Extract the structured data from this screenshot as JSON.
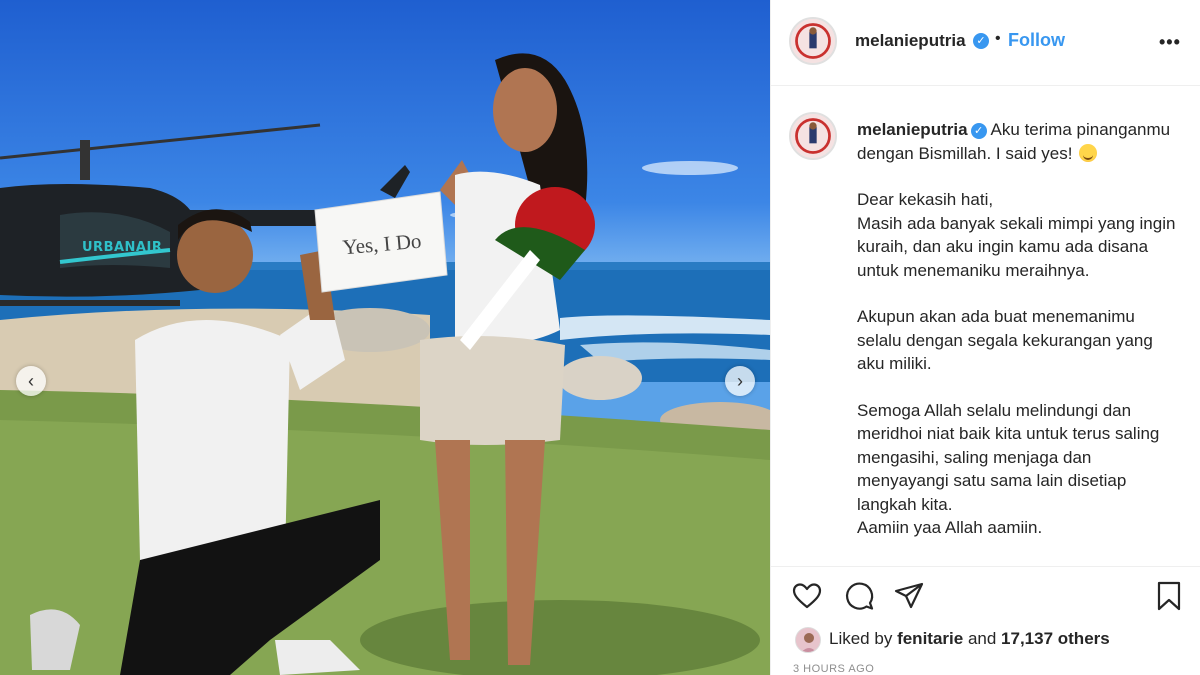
{
  "photo": {
    "sign_text": "Yes, I Do",
    "helicopter_text": "URBANAIR",
    "prev_icon": "chevron-left-icon",
    "next_icon": "chevron-right-icon"
  },
  "header": {
    "username": "melanieputria",
    "verified_icon": "verified-badge-icon",
    "separator": "•",
    "follow_label": "Follow",
    "more_label": "•••"
  },
  "caption": {
    "username": "melanieputria",
    "first_line": "Aku terima pinanganmu dengan Bismillah. I said yes!",
    "emoji": "hugging-face-emoji",
    "paragraphs": [
      [
        "Dear kekasih hati,",
        "Masih ada banyak sekali mimpi yang ingin kuraih, dan aku ingin kamu ada disana untuk menemaniku meraihnya."
      ],
      [
        "Akupun akan ada buat menemanimu selalu dengan segala kekurangan yang aku miliki."
      ],
      [
        "Semoga Allah selalu melindungi dan meridhoi niat baik kita untuk terus saling mengasihi, saling menjaga dan menyayangi satu sama lain disetiap langkah kita.",
        "Aamiin yaa Allah aamiin."
      ]
    ]
  },
  "actions": {
    "like_icon": "heart-icon",
    "comment_icon": "comment-icon",
    "share_icon": "paper-plane-icon",
    "save_icon": "bookmark-icon"
  },
  "likes": {
    "prefix": "Liked by",
    "user": "fenitarie",
    "connector": "and",
    "others": "17,137 others"
  },
  "timestamp": "3 HOURS AGO",
  "colors": {
    "accent": "#3897f0",
    "text": "#262626",
    "muted": "#8e8e8e",
    "border": "#efefef"
  }
}
